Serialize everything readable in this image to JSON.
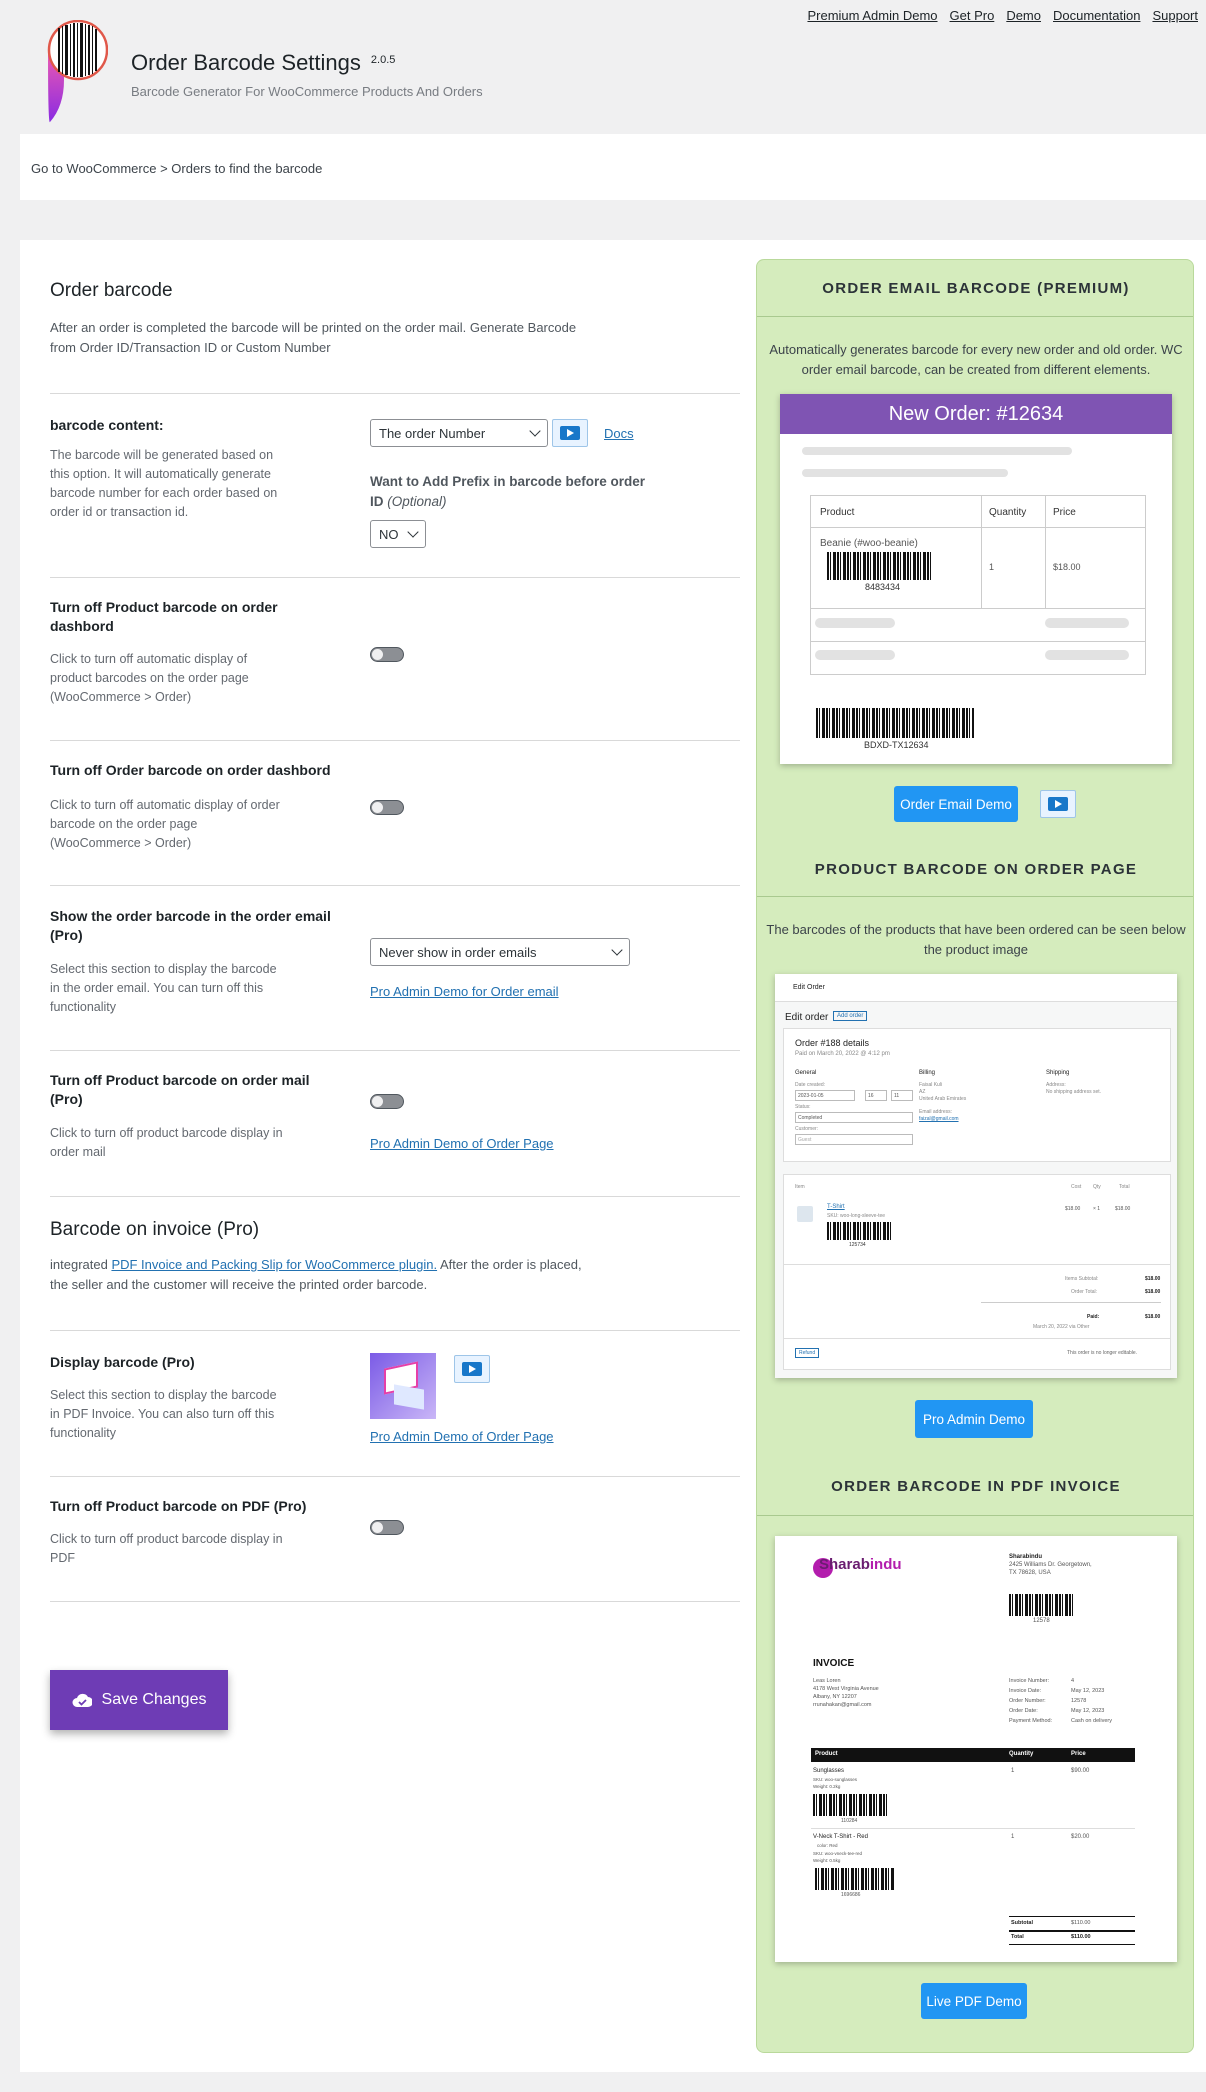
{
  "top_nav": [
    "Premium Admin Demo",
    "Get Pro",
    "Demo",
    "Documentation",
    "Support"
  ],
  "header": {
    "title": "Order Barcode Settings",
    "version": "2.0.5",
    "subtitle": "Barcode Generator For WooCommerce Products And Orders"
  },
  "breadcrumb": "Go to WooCommerce > Orders to find the barcode",
  "order_section": {
    "title": "Order barcode",
    "desc": "After an order is completed the barcode will be printed on the order mail. Generate Barcode from Order ID/Transaction ID or Custom Number"
  },
  "rows": {
    "content": {
      "label": "barcode content:",
      "desc": "The barcode will be generated based on this option. It will automatically generate barcode number for each order based on order id or transaction id.",
      "select": "The order Number",
      "docs": "Docs",
      "prefix_label": "Want to Add Prefix in barcode before order ID",
      "prefix_optional": "(Optional)",
      "prefix_select": "NO"
    },
    "product_dash": {
      "label": "Turn off Product barcode on order dashbord",
      "desc": "Click to turn off automatic display of product barcodes on the order page (WooCommerce > Order)"
    },
    "order_dash": {
      "label": "Turn off Order barcode on order dashbord",
      "desc": "Click to turn off automatic display of order barcode on the order page (WooCommerce > Order)"
    },
    "email": {
      "label": "Show the order barcode in the order email (Pro)",
      "desc": "Select this section to display the barcode in the order email. You can turn off this functionality",
      "select": "Never show in order emails",
      "link": "Pro Admin Demo for Order email"
    },
    "mail": {
      "label": "Turn off Product barcode on order mail (Pro)",
      "desc": "Click to turn off product barcode display in order mail",
      "link": "Pro Admin Demo of Order Page"
    },
    "display": {
      "label": "Display barcode (Pro)",
      "desc": "Select this section to display the barcode in PDF Invoice. You can also turn off this functionality",
      "link": "Pro Admin Demo of Order Page"
    },
    "pdf": {
      "label": "Turn off Product barcode on PDF (Pro)",
      "desc": "Click to turn off product barcode display in PDF"
    }
  },
  "invoice_section": {
    "title": "Barcode on invoice (Pro)",
    "pre": "integrated ",
    "link": "PDF Invoice and Packing Slip for WooCommerce plugin.",
    "post": " After the order is placed, the seller and the customer will receive the printed order barcode."
  },
  "save_label": "Save Changes",
  "panel": {
    "email": {
      "title": "ORDER EMAIL BARCODE (PREMIUM)",
      "desc": "Automatically generates barcode for every new order and old order. WC order email barcode, can be created from different elements.",
      "shot_header": "New Order: #12634",
      "th": [
        "Product",
        "Quantity",
        "Price"
      ],
      "item": "Beanie (#woo-beanie)",
      "item_code": "8483434",
      "qty": "1",
      "price": "$18.00",
      "order_code": "BDXD-TX12634",
      "button": "Order Email Demo"
    },
    "product": {
      "title": "PRODUCT BARCODE ON ORDER PAGE",
      "desc": "The barcodes of the products that have been ordered can be seen below the product image",
      "button": "Pro Admin Demo",
      "shot": {
        "top": "Edit Order",
        "edit": "Edit order",
        "add": "Add order",
        "order": "Order #188 details",
        "paid": "Paid on March 20, 2022 @ 4:12 pm",
        "general": "General",
        "billing": "Billing",
        "shipping": "Shipping",
        "date_label": "Date created:",
        "date": "2023-01-05",
        "hour": "16",
        "min": "11",
        "status_label": "Status:",
        "status": "Completed",
        "customer_label": "Customer:",
        "customer": "Guest",
        "billing_name": "Faisal Kuli",
        "billing_az": "AZ",
        "billing_country": "United Arab Emirates",
        "email_label": "Email address:",
        "email": "faizal@gmail.com",
        "addr_label": "Address:",
        "addr": "No shipping address set.",
        "col_item": "Item",
        "col_cost": "Cost",
        "col_qty": "Qty",
        "col_total": "Total",
        "item": "T-Shirt",
        "sku": "SKU: woo-long-sleeve-tee",
        "cost": "$18.00",
        "qty": "× 1",
        "total": "$18.00",
        "code": "125734",
        "sub_label": "Items Subtotal:",
        "sub": "$18.00",
        "ot_label": "Order Total:",
        "ot": "$18.00",
        "paid_label": "Paid:",
        "paid_val": "$18.00",
        "paid_date": "March 20, 2022 via Other",
        "refund": "Refund",
        "note": "This order is no longer editable."
      }
    },
    "pdf": {
      "title": "ORDER BARCODE IN PDF INVOICE",
      "button": "Live PDF Demo",
      "shot": {
        "brand1": "Sharab",
        "brand2": "indu",
        "co": "Sharabindu",
        "co_addr1": "2425 Williams Dr. Georgetown,",
        "co_addr2": "TX 78628, USA",
        "co_code": "12578",
        "invoice": "INVOICE",
        "cust_name": "Leas Loren",
        "cust_addr1": "4178 West Virginia Avenue",
        "cust_addr2": "Albany, NY 12207",
        "cust_email": "rrunahakan@gmail.com",
        "meta": [
          [
            "Invoice Number:",
            "4"
          ],
          [
            "Invoice Date:",
            "May 12, 2023"
          ],
          [
            "Order Number:",
            "12578"
          ],
          [
            "Order Date:",
            "May 12, 2023"
          ],
          [
            "Payment Method:",
            "Cash on delivery"
          ]
        ],
        "th": [
          "Product",
          "Quantity",
          "Price"
        ],
        "p1": "Sunglasses",
        "p1_sku": "SKU: woo-sunglasses",
        "p1_w": "Weight: 0.2kg",
        "p1_q": "1",
        "p1_p": "$90.00",
        "p1_code": "110284",
        "p2": "V-Neck T-Shirt - Red",
        "p2_color": "color: Red",
        "p2_sku": "SKU: woo-vneck-tee-red",
        "p2_w": "Weight: 0.5kg",
        "p2_q": "1",
        "p2_p": "$20.00",
        "p2_code": "1696686",
        "subtotal_label": "Subtotal",
        "subtotal": "$110.00",
        "total_label": "Total",
        "total": "$110.00"
      }
    }
  }
}
